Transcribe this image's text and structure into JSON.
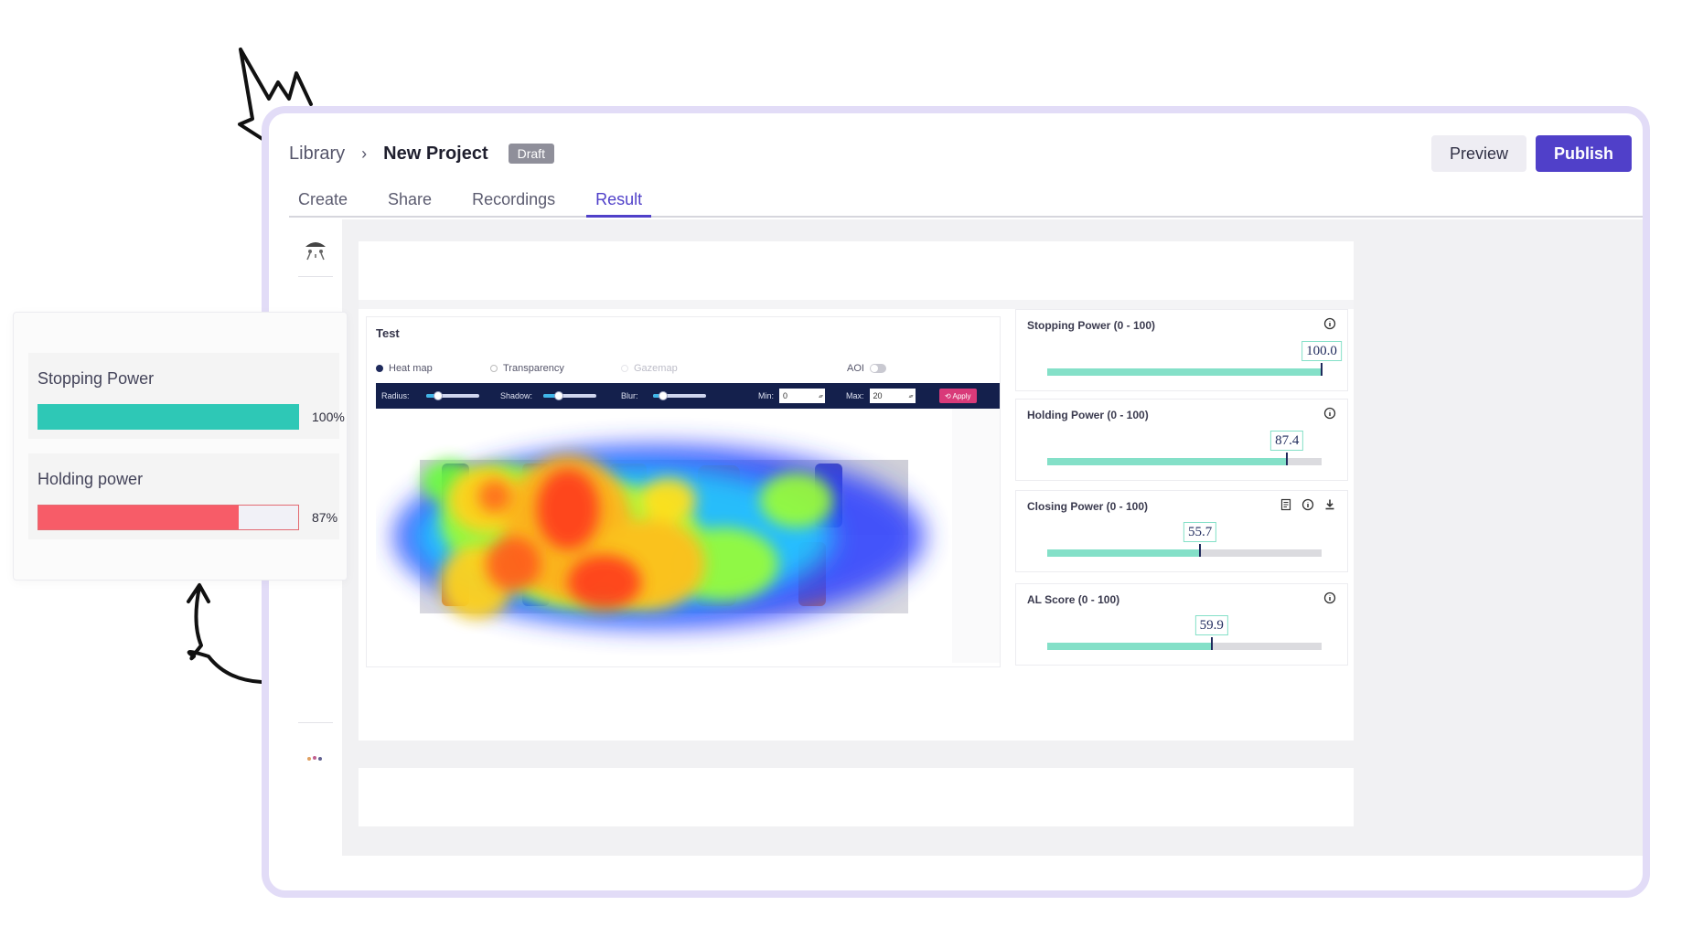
{
  "app": {
    "breadcrumb": {
      "library": "Library",
      "separator": "›",
      "project": "New Project",
      "status_badge": "Draft"
    },
    "actions": {
      "preview": "Preview",
      "publish": "Publish"
    },
    "tabs": [
      {
        "label": "Create",
        "active": false
      },
      {
        "label": "Share",
        "active": false
      },
      {
        "label": "Recordings",
        "active": false
      },
      {
        "label": "Result",
        "active": true
      }
    ]
  },
  "test_panel": {
    "title": "Test",
    "modes": {
      "heatmap": "Heat map",
      "transparency": "Transparency",
      "gazemap": "Gazemap",
      "aoi": "AOI"
    },
    "controls": {
      "radius": "Radius:",
      "shadow": "Shadow:",
      "blur": "Blur:",
      "min_label": "Min:",
      "min_value": "0",
      "max_label": "Max:",
      "max_value": "20",
      "apply": "Apply"
    },
    "heatmap_image": "shelf-products-heatmap"
  },
  "metrics": [
    {
      "title": "Stopping Power (0 - 100)",
      "value": "100.0",
      "fraction": 1.0,
      "icons": [
        "info-icon"
      ]
    },
    {
      "title": "Holding Power (0 - 100)",
      "value": "87.4",
      "fraction": 0.874,
      "icons": [
        "info-icon"
      ]
    },
    {
      "title": "Closing Power (0 - 100)",
      "value": "55.7",
      "fraction": 0.557,
      "icons": [
        "report-icon",
        "info-icon",
        "download-icon"
      ]
    },
    {
      "title": "AL Score (0 - 100)",
      "value": "59.9",
      "fraction": 0.599,
      "icons": [
        "info-icon"
      ]
    }
  ],
  "summary": {
    "stopping": {
      "label": "Stopping Power",
      "value": "100%",
      "fraction": 1.0,
      "color": "#2ec8b6"
    },
    "holding": {
      "label": "Holding power",
      "value": "87%",
      "fraction": 0.77,
      "color": "#f75c68"
    }
  },
  "colors": {
    "accent": "#5040c9",
    "metric_fill": "#84e0c8",
    "dark_bar": "#14204c",
    "frame": "#e2dcf7"
  }
}
